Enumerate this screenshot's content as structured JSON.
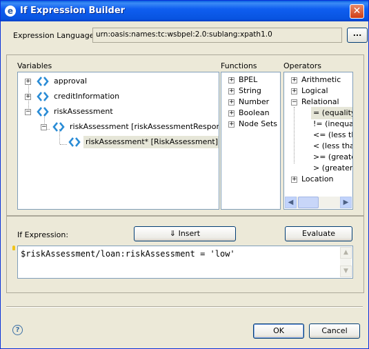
{
  "window": {
    "title": "If Expression Builder",
    "icon": "eclipse-icon"
  },
  "language": {
    "label": "Expression Language:",
    "value": "urn:oasis:names:tc:wsbpel:2.0:sublang:xpath1.0",
    "browse_label": "..."
  },
  "variables": {
    "label": "Variables",
    "items": [
      {
        "label": "approval"
      },
      {
        "label": "creditInformation"
      },
      {
        "label": "riskAssessment"
      },
      {
        "label": "riskAssessment [riskAssessmentResponse]"
      },
      {
        "label": "riskAssessment* [RiskAssessment]"
      }
    ]
  },
  "functions": {
    "label": "Functions",
    "items": [
      "BPEL",
      "String",
      "Number",
      "Boolean",
      "Node Sets"
    ]
  },
  "operators": {
    "label": "Operators",
    "items": [
      "Arithmetic",
      "Logical",
      "Relational",
      "Location"
    ],
    "relational_children": [
      "= (equality",
      "!= (inequali",
      "<= (less th",
      "< (less thar",
      ">= (greate",
      "> (greater"
    ]
  },
  "expression": {
    "label": "If Expression:",
    "insert_label": "⇓ Insert",
    "evaluate_label": "Evaluate",
    "value": "$riskAssessment/loan:riskAssessment = 'low'"
  },
  "footer": {
    "ok_label": "OK",
    "cancel_label": "Cancel",
    "help_label": "?"
  },
  "colors": {
    "titlebar": "#0a5fe0",
    "selection": "#e6e6d8",
    "variable_icon": "#2a8cd6"
  }
}
